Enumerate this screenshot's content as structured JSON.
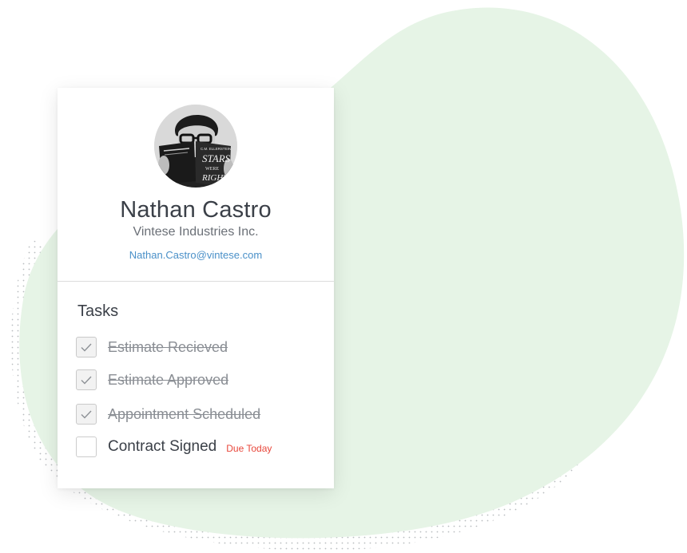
{
  "contact": {
    "name": "Nathan Castro",
    "company": "Vintese Industries Inc.",
    "email": "Nathan.Castro@vintese.com"
  },
  "tasks": {
    "title": "Tasks",
    "items": [
      {
        "label": "Estimate Recieved",
        "done": true
      },
      {
        "label": "Estimate Approved",
        "done": true
      },
      {
        "label": "Appointment Scheduled",
        "done": true
      },
      {
        "label": "Contract Signed",
        "done": false,
        "due": "Due Today"
      }
    ]
  },
  "colors": {
    "blob": "#e6f4e6",
    "email": "#4a90c8",
    "due": "#e8473b",
    "text_dark": "#3b4048"
  },
  "avatar": {
    "book_title_top": "C.M. ELLERSTEIN",
    "book_title_main": "STARS",
    "book_title_sub": "WERE",
    "book_title_end": "RIGHT"
  }
}
